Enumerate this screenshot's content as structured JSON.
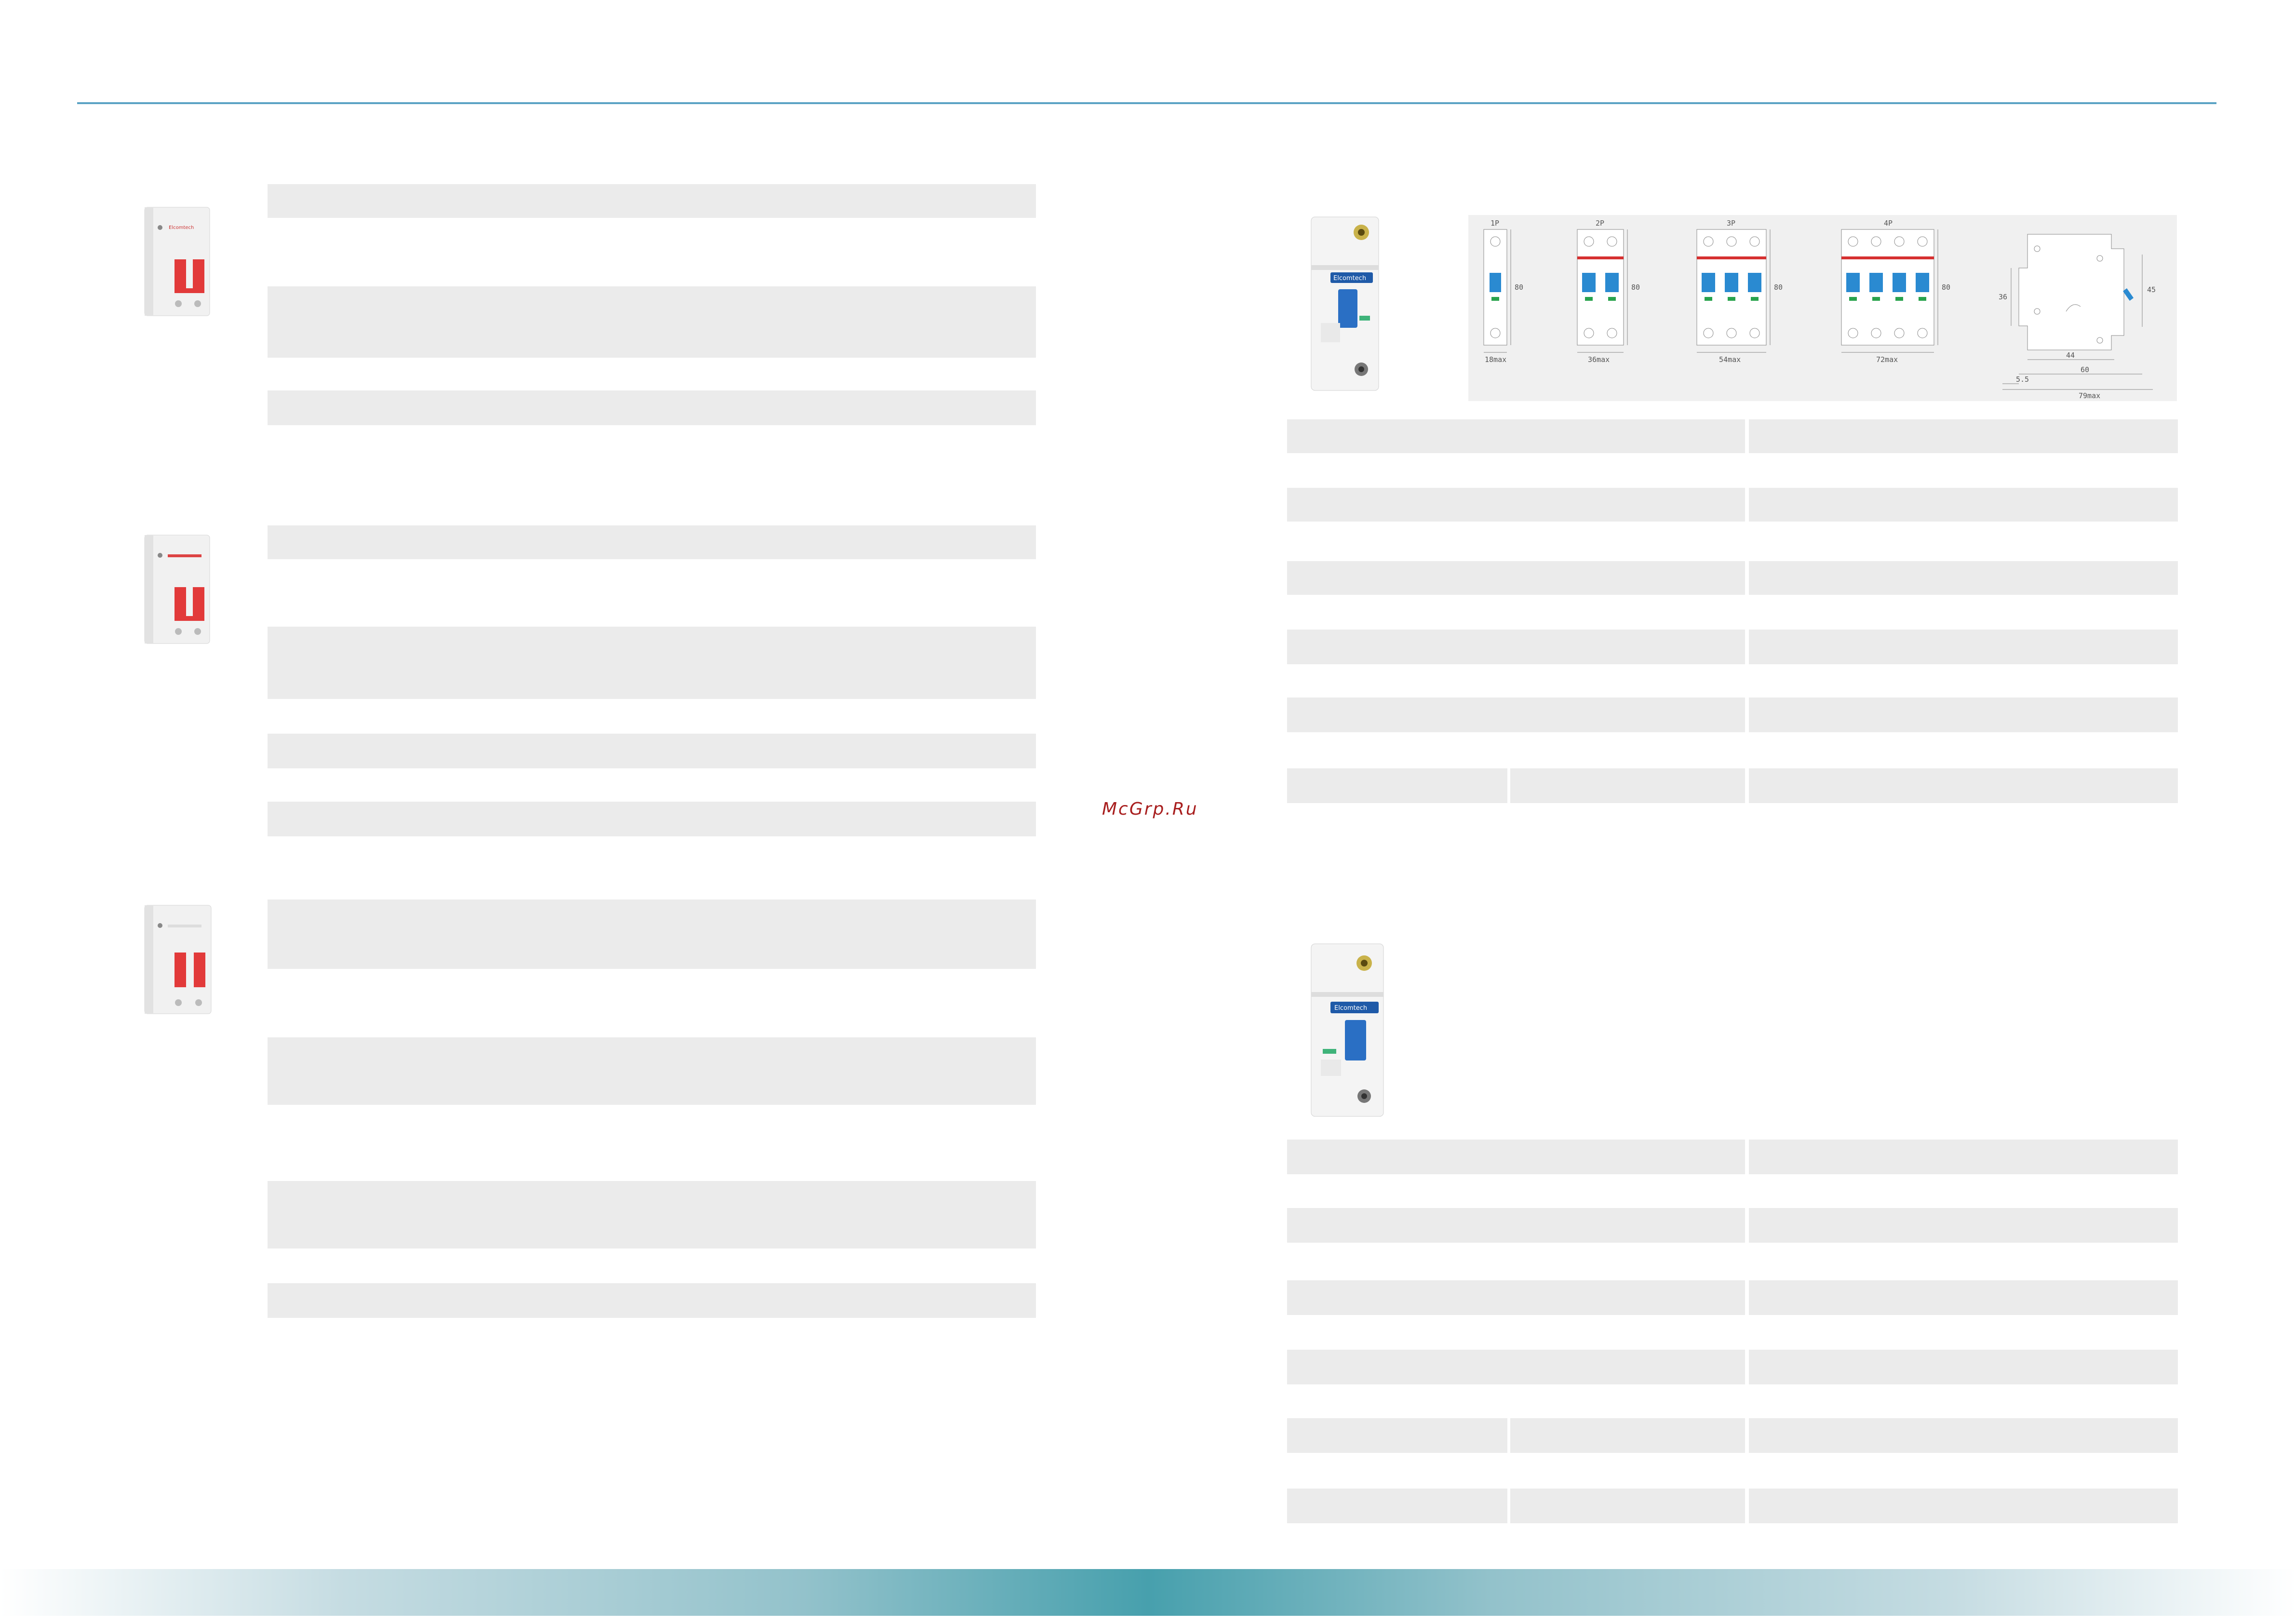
{
  "watermark": "McGrp.Ru",
  "brand_label": "Elcomtech",
  "diagram": {
    "pole_labels": [
      "1P",
      "2P",
      "3P",
      "4P"
    ],
    "width_labels": [
      "18max",
      "36max",
      "54max",
      "72max"
    ],
    "height_label": "80",
    "side_dims": {
      "d1": "36",
      "d2": "45",
      "d3": "44",
      "d4": "60",
      "d5": "79max",
      "d6": "5.5"
    }
  },
  "colors": {
    "accent_line": "#5aa3c4",
    "row_fill": "#ebebeb",
    "breaker_red": "#e23a3a",
    "breaker_blue": "#2a6fc4",
    "footer_teal": "#47a0ad",
    "watermark": "#a81e1e"
  }
}
